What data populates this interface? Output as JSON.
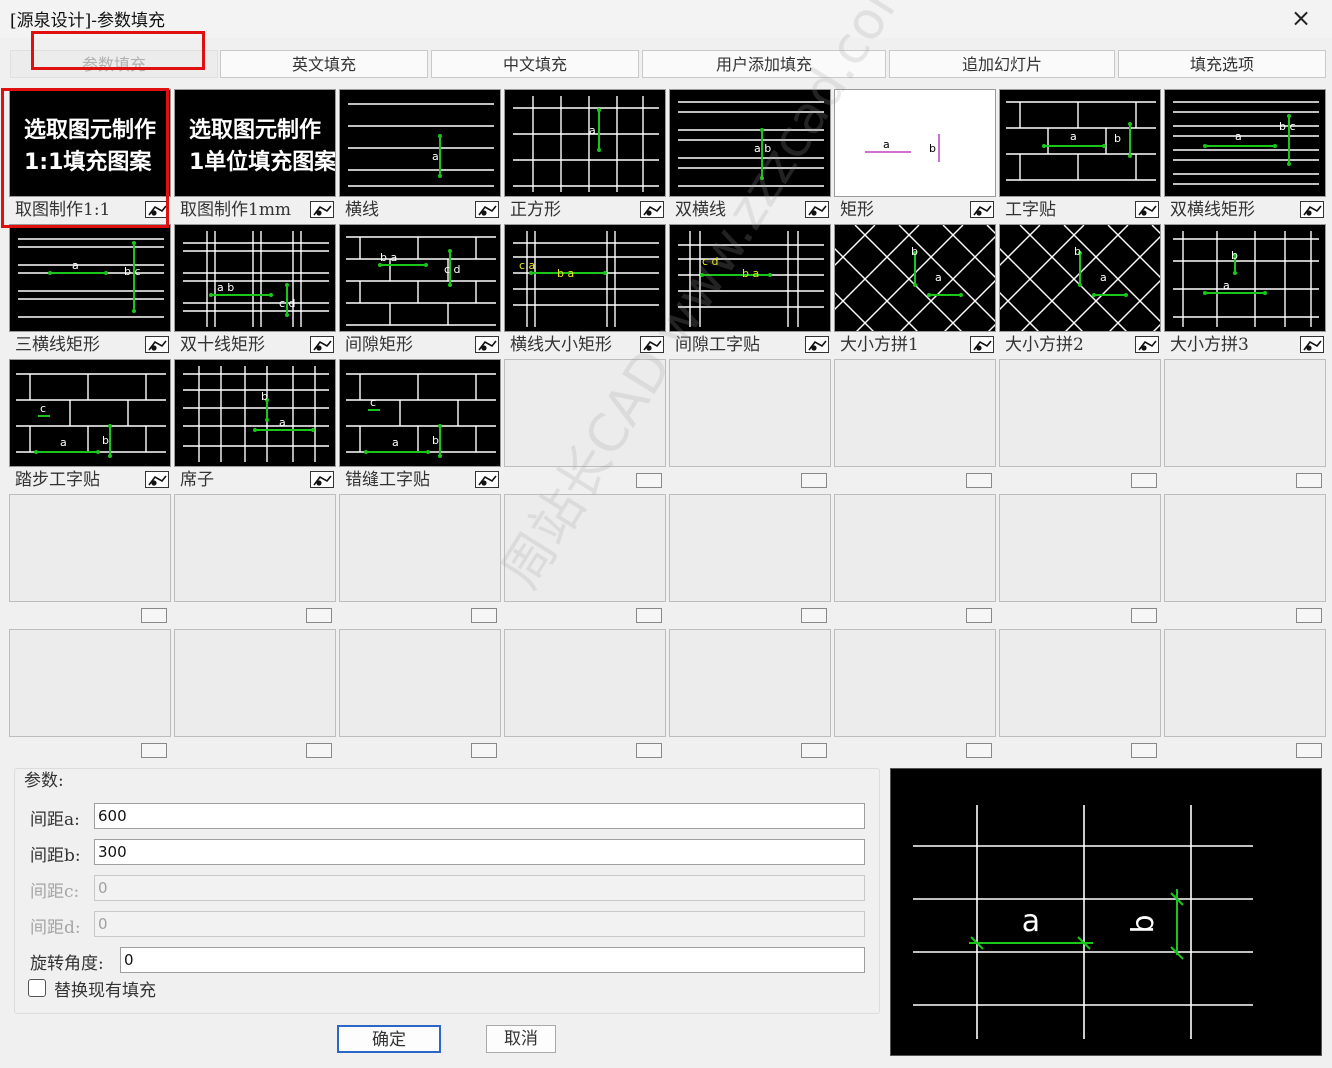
{
  "window": {
    "title": "[源泉设计]-参数填充",
    "close_icon": "×"
  },
  "tabs": [
    "参数填充",
    "英文填充",
    "中文填充",
    "用户添加填充",
    "追加幻灯片",
    "填充选项"
  ],
  "patterns": [
    {
      "label": "取图制作1:1",
      "line1": "选取图元制作",
      "line2": "1:1填充图案"
    },
    {
      "label": "取图制作1mm",
      "line1": "选取图元制作",
      "line2": "1单位填充图案"
    },
    {
      "label": "横线"
    },
    {
      "label": "正方形"
    },
    {
      "label": "双横线"
    },
    {
      "label": "矩形"
    },
    {
      "label": "工字贴"
    },
    {
      "label": "双横线矩形"
    },
    {
      "label": "三横线矩形"
    },
    {
      "label": "双十线矩形"
    },
    {
      "label": "间隙矩形"
    },
    {
      "label": "横线大小矩形"
    },
    {
      "label": "间隙工字贴"
    },
    {
      "label": "大小方拼1"
    },
    {
      "label": "大小方拼2"
    },
    {
      "label": "大小方拼3"
    },
    {
      "label": "踏步工字贴"
    },
    {
      "label": "席子"
    },
    {
      "label": "错缝工字贴"
    }
  ],
  "params": {
    "group_label": "参数:",
    "a_label": "间距a:",
    "a_value": "600",
    "b_label": "间距b:",
    "b_value": "300",
    "c_label": "间距c:",
    "c_value": "0",
    "d_label": "间距d:",
    "d_value": "0",
    "rot_label": "旋转角度:",
    "rot_value": "0",
    "replace_label": "替换现有填充"
  },
  "buttons": {
    "ok": "确定",
    "cancel": "取消"
  },
  "preview": {
    "a": "a",
    "b": "b"
  },
  "watermark": "周站长CAD www.zzzcad.com",
  "colors": {
    "accent_red": "#e01010",
    "dim_green": "#19c619",
    "magenta": "#d070d0",
    "yellow": "#e8e820"
  }
}
